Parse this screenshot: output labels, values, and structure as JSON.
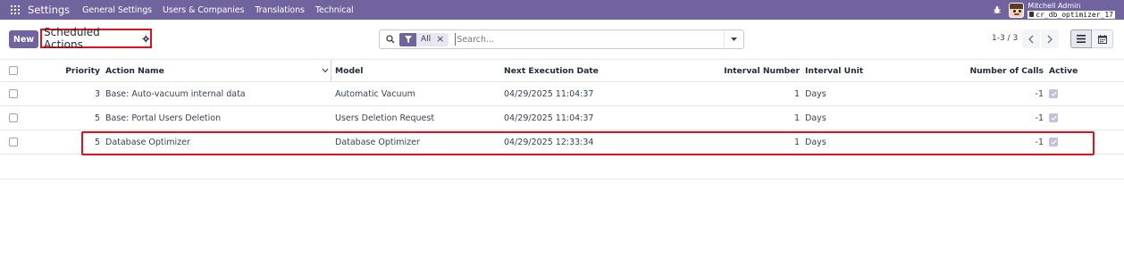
{
  "navbar": {
    "app_title": "Settings",
    "menu": [
      "General Settings",
      "Users & Companies",
      "Translations",
      "Technical"
    ],
    "user_name": "Mitchell Admin",
    "db_name": "cr_db_optimizer_17"
  },
  "control_panel": {
    "new_label": "New",
    "breadcrumb_title": "Scheduled Actions",
    "search": {
      "facet_label": "All",
      "placeholder": "Search..."
    },
    "pager": "1-3 / 3"
  },
  "table": {
    "columns": {
      "priority": "Priority",
      "action_name": "Action Name",
      "model": "Model",
      "next_exec": "Next Execution Date",
      "interval_number": "Interval Number",
      "interval_unit": "Interval Unit",
      "number_of_calls": "Number of Calls",
      "active": "Active"
    },
    "rows": [
      {
        "priority": "3",
        "action_name": "Base: Auto-vacuum internal data",
        "model": "Automatic Vacuum",
        "next_exec": "04/29/2025 11:04:37",
        "interval_number": "1",
        "interval_unit": "Days",
        "number_of_calls": "-1",
        "active": true
      },
      {
        "priority": "5",
        "action_name": "Base: Portal Users Deletion",
        "model": "Users Deletion Request",
        "next_exec": "04/29/2025 11:04:37",
        "interval_number": "1",
        "interval_unit": "Days",
        "number_of_calls": "-1",
        "active": true
      },
      {
        "priority": "5",
        "action_name": "Database Optimizer",
        "model": "Database Optimizer",
        "next_exec": "04/29/2025 12:33:34",
        "interval_number": "1",
        "interval_unit": "Days",
        "number_of_calls": "-1",
        "active": true
      }
    ]
  },
  "colors": {
    "brand": "#71639e",
    "highlight": "#e0101e",
    "active_check": "#c7bcdd"
  }
}
